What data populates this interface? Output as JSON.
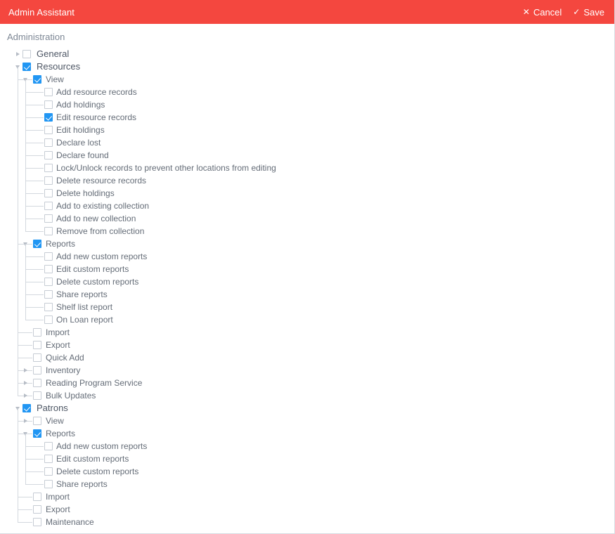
{
  "titlebar": {
    "title": "Admin Assistant",
    "cancel_label": "Cancel",
    "cancel_icon": "close-x-icon",
    "save_label": "Save",
    "save_icon": "check-mark-icon",
    "background_color": "#f4473f",
    "text_color": "#ffffff"
  },
  "colors": {
    "accent_checked": "#2196f3",
    "checkbox_border": "#c6ccd4",
    "tree_line": "#d3d8de",
    "label_text": "#646c77",
    "section_text": "#7d8795"
  },
  "section": {
    "title": "Administration"
  },
  "tree": [
    {
      "level": 1,
      "label": "General",
      "checked": false,
      "arrow": "right"
    },
    {
      "level": 1,
      "label": "Resources",
      "checked": true,
      "arrow": "down"
    },
    {
      "level": 2,
      "label": "View",
      "checked": true,
      "arrow": "down"
    },
    {
      "level": 3,
      "label": "Add resource records",
      "checked": false,
      "arrow": "none"
    },
    {
      "level": 3,
      "label": "Add holdings",
      "checked": false,
      "arrow": "none"
    },
    {
      "level": 3,
      "label": "Edit resource records",
      "checked": true,
      "arrow": "none"
    },
    {
      "level": 3,
      "label": "Edit holdings",
      "checked": false,
      "arrow": "none"
    },
    {
      "level": 3,
      "label": "Declare lost",
      "checked": false,
      "arrow": "none"
    },
    {
      "level": 3,
      "label": "Declare found",
      "checked": false,
      "arrow": "none"
    },
    {
      "level": 3,
      "label": "Lock/Unlock records to prevent other locations from editing",
      "checked": false,
      "arrow": "none"
    },
    {
      "level": 3,
      "label": "Delete resource records",
      "checked": false,
      "arrow": "none"
    },
    {
      "level": 3,
      "label": "Delete holdings",
      "checked": false,
      "arrow": "none"
    },
    {
      "level": 3,
      "label": "Add to existing collection",
      "checked": false,
      "arrow": "none"
    },
    {
      "level": 3,
      "label": "Add to new collection",
      "checked": false,
      "arrow": "none"
    },
    {
      "level": 3,
      "label": "Remove from collection",
      "checked": false,
      "arrow": "none"
    },
    {
      "level": 2,
      "label": "Reports",
      "checked": true,
      "arrow": "down"
    },
    {
      "level": 3,
      "label": "Add new custom reports",
      "checked": false,
      "arrow": "none"
    },
    {
      "level": 3,
      "label": "Edit custom reports",
      "checked": false,
      "arrow": "none"
    },
    {
      "level": 3,
      "label": "Delete custom reports",
      "checked": false,
      "arrow": "none"
    },
    {
      "level": 3,
      "label": "Share reports",
      "checked": false,
      "arrow": "none"
    },
    {
      "level": 3,
      "label": "Shelf list report",
      "checked": false,
      "arrow": "none"
    },
    {
      "level": 3,
      "label": "On Loan report",
      "checked": false,
      "arrow": "none"
    },
    {
      "level": 2,
      "label": "Import",
      "checked": false,
      "arrow": "none"
    },
    {
      "level": 2,
      "label": "Export",
      "checked": false,
      "arrow": "none"
    },
    {
      "level": 2,
      "label": "Quick Add",
      "checked": false,
      "arrow": "none"
    },
    {
      "level": 2,
      "label": "Inventory",
      "checked": false,
      "arrow": "right"
    },
    {
      "level": 2,
      "label": "Reading Program Service",
      "checked": false,
      "arrow": "right"
    },
    {
      "level": 2,
      "label": "Bulk Updates",
      "checked": false,
      "arrow": "right"
    },
    {
      "level": 1,
      "label": "Patrons",
      "checked": true,
      "arrow": "down"
    },
    {
      "level": 2,
      "label": "View",
      "checked": false,
      "arrow": "right"
    },
    {
      "level": 2,
      "label": "Reports",
      "checked": true,
      "arrow": "down"
    },
    {
      "level": 3,
      "label": "Add new custom reports",
      "checked": false,
      "arrow": "none"
    },
    {
      "level": 3,
      "label": "Edit custom reports",
      "checked": false,
      "arrow": "none"
    },
    {
      "level": 3,
      "label": "Delete custom reports",
      "checked": false,
      "arrow": "none"
    },
    {
      "level": 3,
      "label": "Share reports",
      "checked": false,
      "arrow": "none"
    },
    {
      "level": 2,
      "label": "Import",
      "checked": false,
      "arrow": "none"
    },
    {
      "level": 2,
      "label": "Export",
      "checked": false,
      "arrow": "none"
    },
    {
      "level": 2,
      "label": "Maintenance",
      "checked": false,
      "arrow": "none"
    }
  ]
}
